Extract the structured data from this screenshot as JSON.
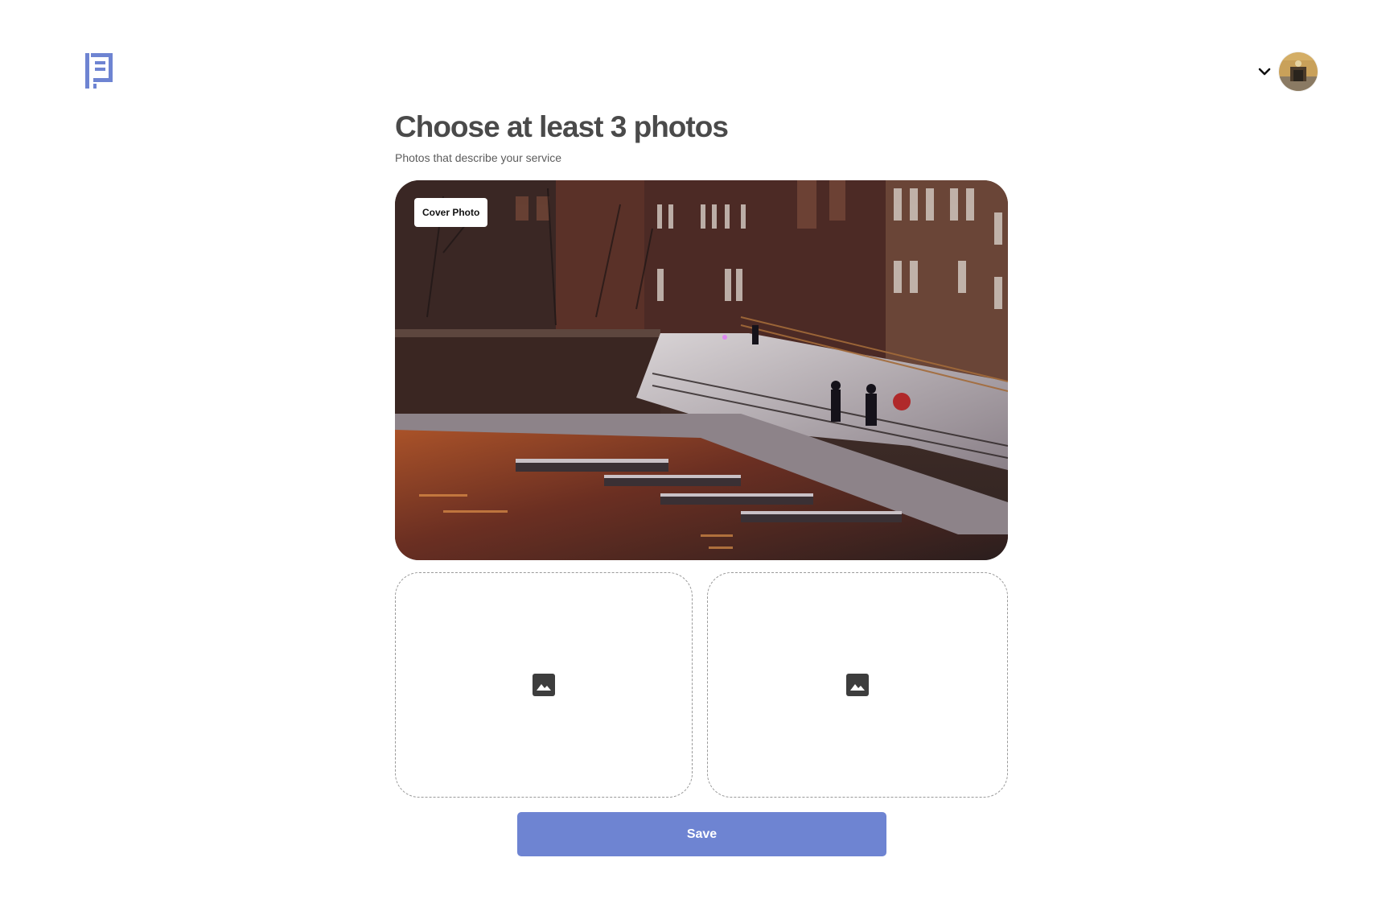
{
  "header": {
    "logo_icon": "notebook-logo-icon",
    "menu_icon": "chevron-down-icon",
    "avatar_icon": "user-avatar"
  },
  "main": {
    "title": "Choose at least 3 photos",
    "subtitle": "Photos that describe your service",
    "cover_badge": "Cover Photo",
    "placeholder_icon": "image-icon",
    "save_label": "Save"
  },
  "colors": {
    "brand": "#6e84d2",
    "title": "#4a4a4a",
    "subtitle": "#5c5c5c",
    "dashed_border": "#9a9a9a"
  }
}
